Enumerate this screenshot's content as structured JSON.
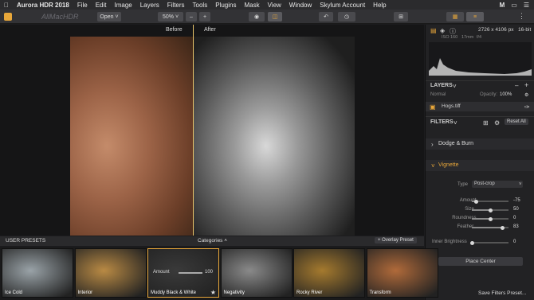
{
  "menubar": {
    "app": "Aurora HDR 2018",
    "items": [
      "File",
      "Edit",
      "Image",
      "Layers",
      "Filters",
      "Tools",
      "Plugins",
      "Mask",
      "View",
      "Window",
      "Skylum Account",
      "Help"
    ],
    "clock_hint": "M"
  },
  "toolbar": {
    "open_label": "Open",
    "zoom": "50%",
    "minus": "–",
    "plus": "+"
  },
  "canvas": {
    "before_label": "Before",
    "after_label": "After",
    "watermark": "AllMacHDR"
  },
  "panel": {
    "dimensions": "2726 x 4106 px",
    "bitdepth": "16-bit",
    "exif": [
      "ISO 160",
      "17mm",
      "f/4"
    ],
    "layers_title": "LAYERS",
    "blend_mode": "Normal",
    "opacity_label": "Opacity:",
    "opacity_value": "100%",
    "layer_name": "Hogs.tiff",
    "filters_title": "FILTERS",
    "reset_all": "Reset All",
    "dodge_burn": "Dodge & Burn",
    "vignette": "Vignette",
    "type_label": "Type",
    "type_value": "Post-crop",
    "params": [
      {
        "label": "Amount",
        "value": "-75",
        "level": 0.12
      },
      {
        "label": "Size",
        "value": "50",
        "level": 0.5
      },
      {
        "label": "Roundness",
        "value": "0",
        "level": 0.5
      },
      {
        "label": "Feather",
        "value": "83",
        "level": 0.83
      },
      {
        "label": "Inner Brightness",
        "value": "0",
        "level": 0.0
      }
    ],
    "place_center": "Place Center",
    "save_preset": "Save Filters Preset..."
  },
  "presets": {
    "title": "USER PRESETS",
    "categories": "Categories",
    "overlay": "+ Overlay Preset",
    "items": [
      {
        "label": "Ice Cold",
        "color": "#9aa3a8"
      },
      {
        "label": "Interior",
        "color": "#b98a44"
      },
      {
        "label": "Muddy Black & White",
        "color": "#3a3a3a"
      },
      {
        "label": "Negativity",
        "color": "#8a8a8a"
      },
      {
        "label": "Rocky River",
        "color": "#a57a2e"
      },
      {
        "label": "Transform",
        "color": "#b06a3a"
      }
    ],
    "active_amount_label": "Amount",
    "active_amount_value": "100"
  }
}
